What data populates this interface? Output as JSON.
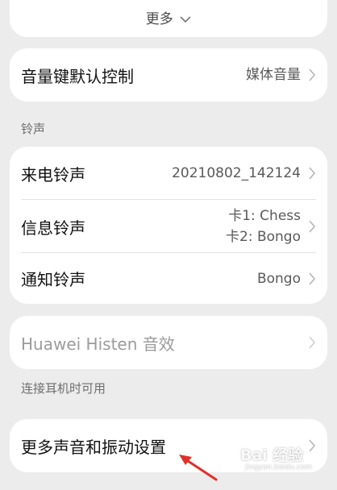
{
  "top": {
    "more_label": "更多"
  },
  "volume_card": {
    "label": "音量键默认控制",
    "value": "媒体音量"
  },
  "ringtone_section": {
    "header": "铃声"
  },
  "ringtone_card": {
    "incoming": {
      "label": "来电铃声",
      "value": "20210802_142124"
    },
    "message": {
      "label": "信息铃声",
      "value_line1": "卡1: Chess",
      "value_line2": "卡2: Bongo"
    },
    "notification": {
      "label": "通知铃声",
      "value": "Bongo"
    }
  },
  "histen_card": {
    "label": "Huawei Histen 音效"
  },
  "headphone_section": {
    "header": "连接耳机时可用"
  },
  "more_sound_card": {
    "label": "更多声音和振动设置"
  },
  "annotation": {
    "arrow_color": "#e0302a"
  },
  "watermark": {
    "brand": "Bai 经验",
    "url": "jingyan.baidu.com"
  }
}
